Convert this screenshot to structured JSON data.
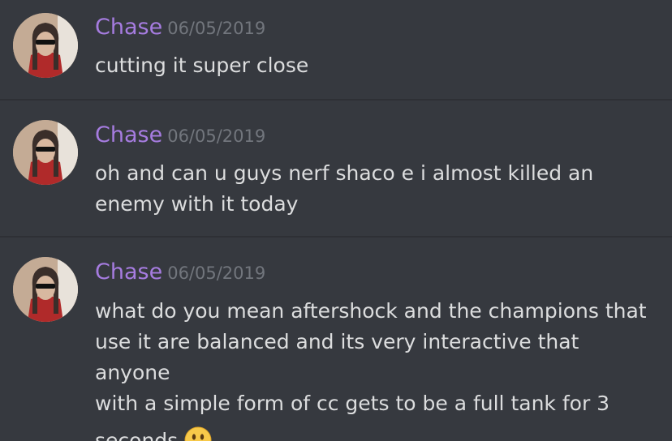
{
  "messages": [
    {
      "author": "Chase",
      "timestamp": "06/05/2019",
      "lines": [
        "cutting it super close"
      ]
    },
    {
      "author": "Chase",
      "timestamp": "06/05/2019",
      "lines": [
        "oh and can u guys nerf shaco e i almost killed an",
        "enemy with it today"
      ]
    },
    {
      "author": "Chase",
      "timestamp": "06/05/2019",
      "lines": [
        "what do you mean aftershock and the champions that",
        "use it are balanced and its very interactive that anyone",
        "with a simple form of cc gets to be a full tank for 3",
        "seconds"
      ],
      "emoji": "smiley-emoji"
    }
  ],
  "colors": {
    "background": "#36393f",
    "username": "#a67ce0",
    "timestamp": "#72767d",
    "text": "#dcddde"
  }
}
